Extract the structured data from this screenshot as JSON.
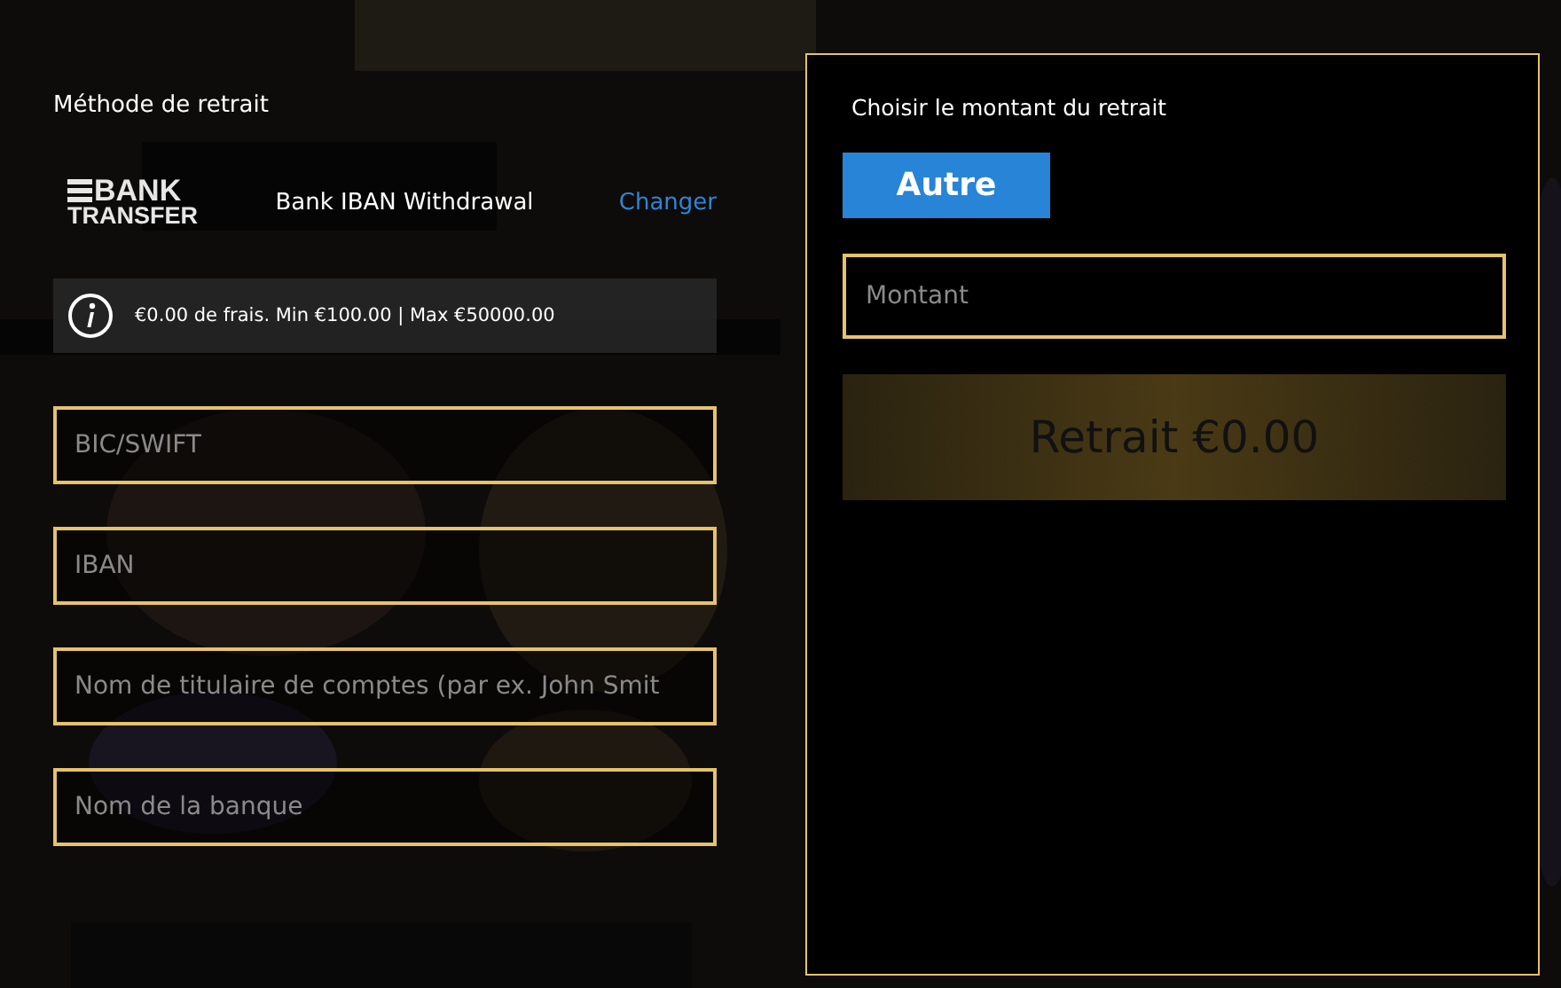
{
  "method": {
    "heading": "Méthode de retrait",
    "logo": {
      "top": "BANK",
      "bottom": "TRANSFER"
    },
    "name": "Bank IBAN Withdrawal",
    "change_link": "Changer"
  },
  "info": {
    "text": "€0.00 de frais. Min €100.00 | Max €50000.00"
  },
  "fields": [
    {
      "placeholder": "BIC/SWIFT"
    },
    {
      "placeholder": "IBAN"
    },
    {
      "placeholder": "Nom de titulaire de comptes (par ex. John Smit"
    },
    {
      "placeholder": "Nom de la banque"
    }
  ],
  "amount_panel": {
    "heading": "Choisir le montant du retrait",
    "options": [
      {
        "label": "Autre",
        "selected": true
      }
    ],
    "amount_field": {
      "placeholder": "Montant"
    },
    "submit_button": {
      "label": "Retrait €0.00",
      "disabled": true
    }
  }
}
